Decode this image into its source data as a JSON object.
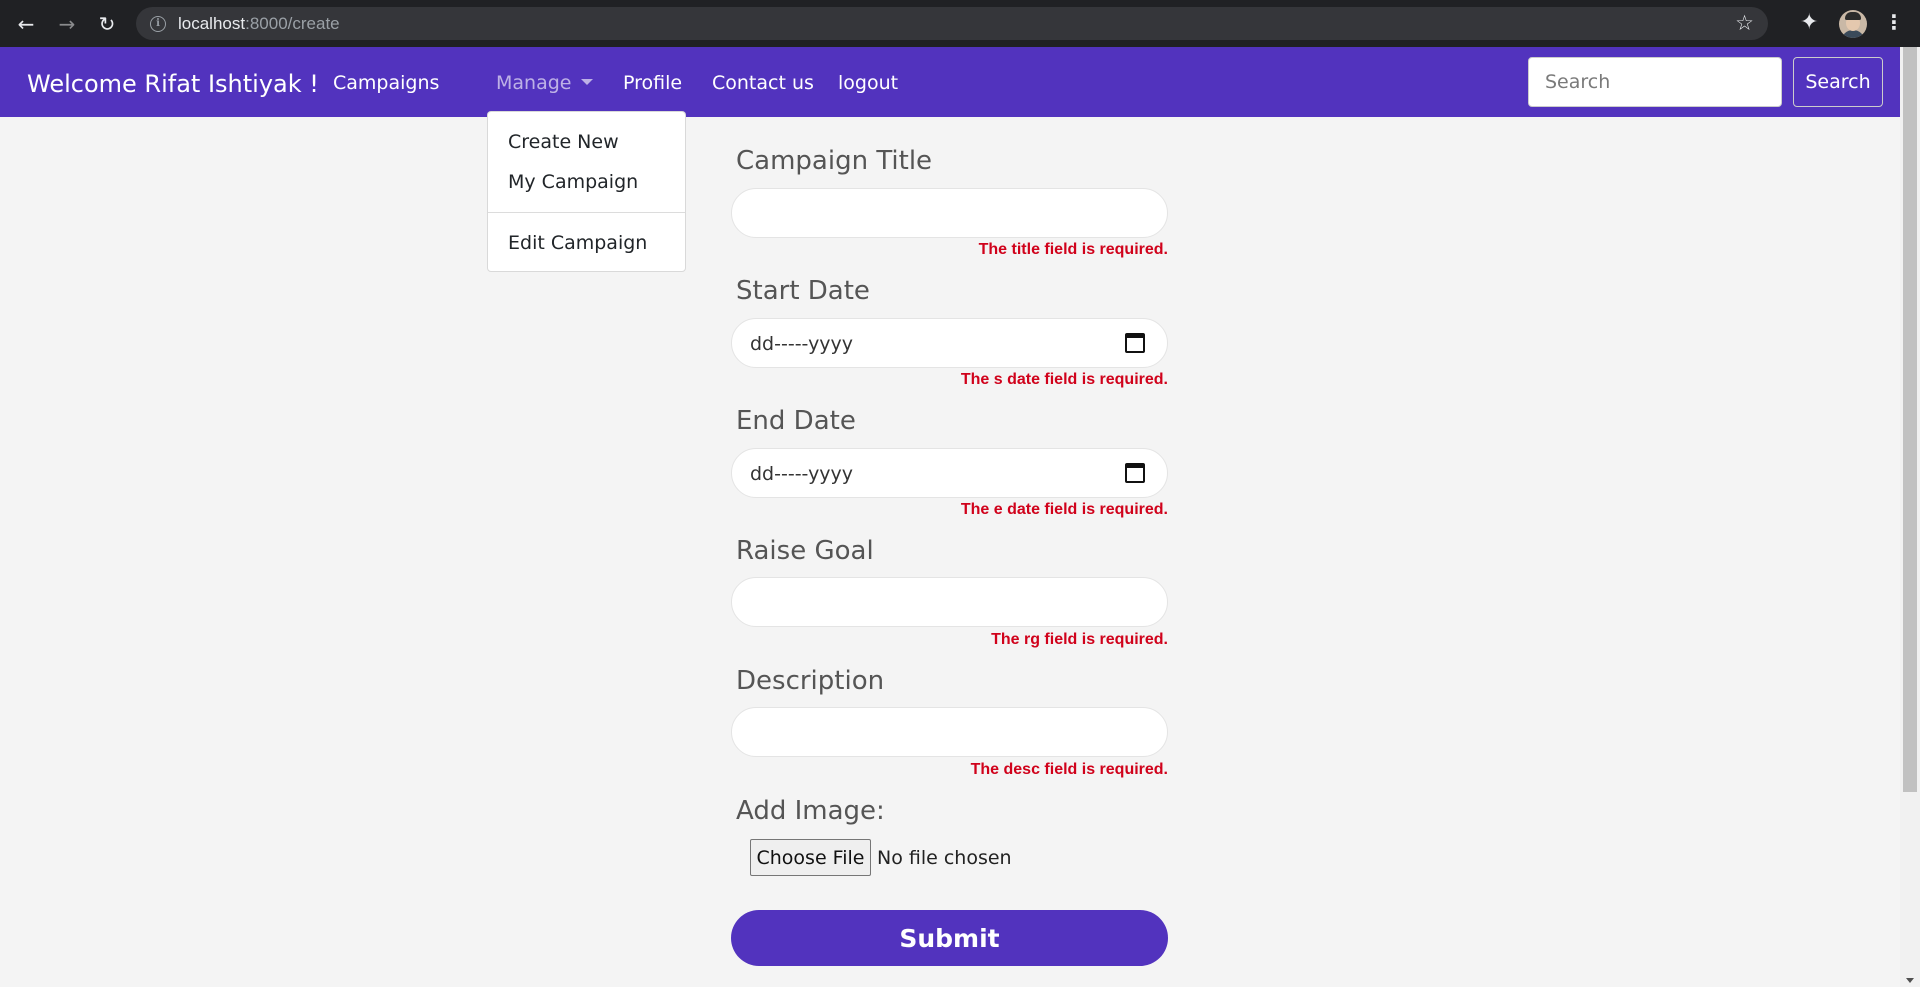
{
  "browser": {
    "url_host": "localhost",
    "url_rest": ":8000/create",
    "icons": [
      "back-icon",
      "forward-icon",
      "reload-icon",
      "info-icon",
      "star-icon",
      "extensions-icon",
      "profile-avatar",
      "more-icon"
    ]
  },
  "navbar": {
    "brand": "Welcome Rifat Ishtiyak !",
    "links": {
      "campaigns": "Campaigns",
      "manage": "Manage",
      "profile": "Profile",
      "contact": "Contact us",
      "logout": "logout"
    },
    "search_placeholder": "Search",
    "search_button": "Search",
    "color": "#5233be"
  },
  "dropdown": {
    "items": [
      "Create New",
      "My Campaign",
      "Edit Campaign"
    ]
  },
  "form": {
    "title": {
      "label": "Campaign Title",
      "value": "",
      "error": "The title field is required."
    },
    "start_date": {
      "label": "Start Date",
      "placeholder": "dd-----yyyy",
      "error": "The s date field is required."
    },
    "end_date": {
      "label": "End Date",
      "placeholder": "dd-----yyyy",
      "error": "The e date field is required."
    },
    "raise_goal": {
      "label": "Raise Goal",
      "value": "",
      "error": "The rg field is required."
    },
    "description": {
      "label": "Description",
      "value": "",
      "error": "The desc field is required."
    },
    "image": {
      "label": "Add Image:",
      "button": "Choose File",
      "status": "No file chosen"
    },
    "submit": "Submit",
    "error_color": "#d0021b"
  }
}
